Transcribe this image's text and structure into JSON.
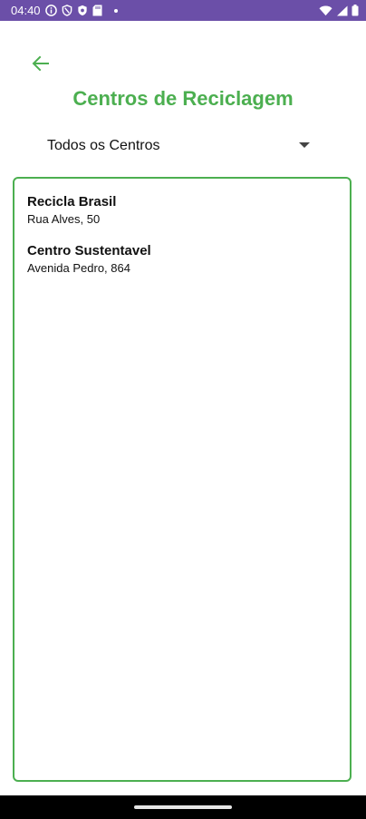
{
  "status_bar": {
    "time": "04:40",
    "icons_left": [
      "info-icon",
      "shield-outline-icon",
      "shield-icon",
      "sd-card-icon",
      "dot-icon"
    ],
    "icons_right": [
      "wifi-icon",
      "signal-icon",
      "battery-icon"
    ]
  },
  "header": {
    "back_icon": "arrow-left-icon",
    "title": "Centros de Reciclagem"
  },
  "filter": {
    "selected": "Todos os Centros"
  },
  "centers": [
    {
      "name": "Recicla Brasil",
      "address": "Rua Alves, 50"
    },
    {
      "name": "Centro Sustentavel",
      "address": "Avenida Pedro, 864"
    }
  ],
  "colors": {
    "accent": "#4caf50",
    "status_bar": "#6b4fa8"
  }
}
